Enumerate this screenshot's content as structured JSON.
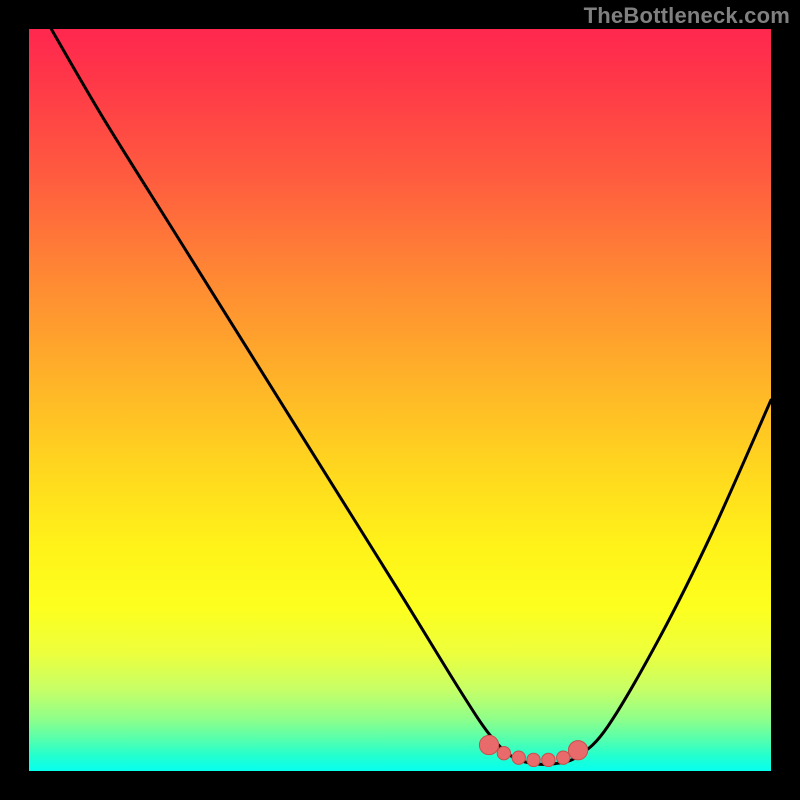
{
  "watermark": "TheBottleneck.com",
  "colors": {
    "frame": "#000000",
    "curve": "#000000",
    "marker_fill": "#e86a6a",
    "marker_stroke": "#c94f4f",
    "gradient_top": "#ff274f",
    "gradient_bottom": "#07ffee"
  },
  "chart_data": {
    "type": "line",
    "title": "",
    "xlabel": "",
    "ylabel": "",
    "xlim": [
      0,
      100
    ],
    "ylim": [
      0,
      100
    ],
    "grid": false,
    "legend": false,
    "series": [
      {
        "name": "bottleneck-curve",
        "x": [
          3,
          10,
          20,
          30,
          40,
          50,
          58,
          62,
          65,
          68,
          71,
          74,
          78,
          85,
          92,
          100
        ],
        "values": [
          100,
          88,
          72,
          56,
          40,
          24,
          11,
          5,
          2,
          1,
          1,
          2,
          6,
          18,
          32,
          50
        ]
      }
    ],
    "markers": [
      {
        "name": "sweet-spot-left",
        "x": 62,
        "y": 3.5,
        "r": 1.3
      },
      {
        "name": "sweet-spot-1",
        "x": 64,
        "y": 2.4,
        "r": 0.9
      },
      {
        "name": "sweet-spot-2",
        "x": 66,
        "y": 1.8,
        "r": 0.9
      },
      {
        "name": "sweet-spot-3",
        "x": 68,
        "y": 1.5,
        "r": 0.9
      },
      {
        "name": "sweet-spot-4",
        "x": 70,
        "y": 1.5,
        "r": 0.9
      },
      {
        "name": "sweet-spot-5",
        "x": 72,
        "y": 1.8,
        "r": 0.9
      },
      {
        "name": "sweet-spot-right",
        "x": 74,
        "y": 2.8,
        "r": 1.3
      }
    ]
  }
}
